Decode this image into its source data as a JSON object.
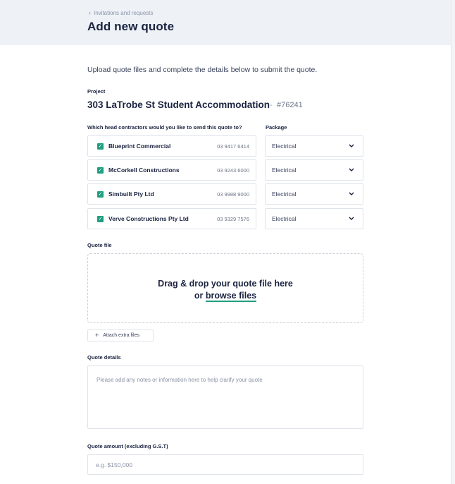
{
  "header": {
    "breadcrumb": "Invitations and requests",
    "title": "Add new quote"
  },
  "intro": "Upload quote files and complete the details below to submit the quote.",
  "project": {
    "label": "Project",
    "name": "303 LaTrobe St Student Accommodation",
    "separator": "-",
    "id": "#76241"
  },
  "contractors": {
    "label": "Which head contractors would you like to send this quote to?",
    "package_label": "Package",
    "items": [
      {
        "name": "Blueprint Commercial",
        "phone": "03 9417 6414",
        "checked": true,
        "package": "Electrical"
      },
      {
        "name": "McCorkell Constructions",
        "phone": "03 9243 6000",
        "checked": true,
        "package": "Electrical"
      },
      {
        "name": "Simbuilt Pty Ltd",
        "phone": "03 9988 9000",
        "checked": true,
        "package": "Electrical"
      },
      {
        "name": "Verve Constructions Pty Ltd",
        "phone": "03 9329 7576",
        "checked": true,
        "package": "Electrical"
      }
    ]
  },
  "quote_file": {
    "label": "Quote file",
    "drop_text": "Drag & drop your quote file here",
    "or_text": "or",
    "browse_text": "browse files",
    "attach_label": "Attach extra files"
  },
  "quote_details": {
    "label": "Quote details",
    "placeholder": "Please add any notes or information here to help clarify your quote"
  },
  "quote_amount": {
    "label": "Quote amount (excluding G.S.T)",
    "placeholder": "e.g. $150,000"
  },
  "colors": {
    "accent": "#1f9f7f",
    "header_bg": "#eef2f7",
    "text_primary": "#1b2340"
  },
  "icons": {
    "breadcrumb": "chevron-left-icon",
    "checkbox": "check-icon",
    "select": "chevron-down-icon",
    "attach": "plus-icon"
  }
}
